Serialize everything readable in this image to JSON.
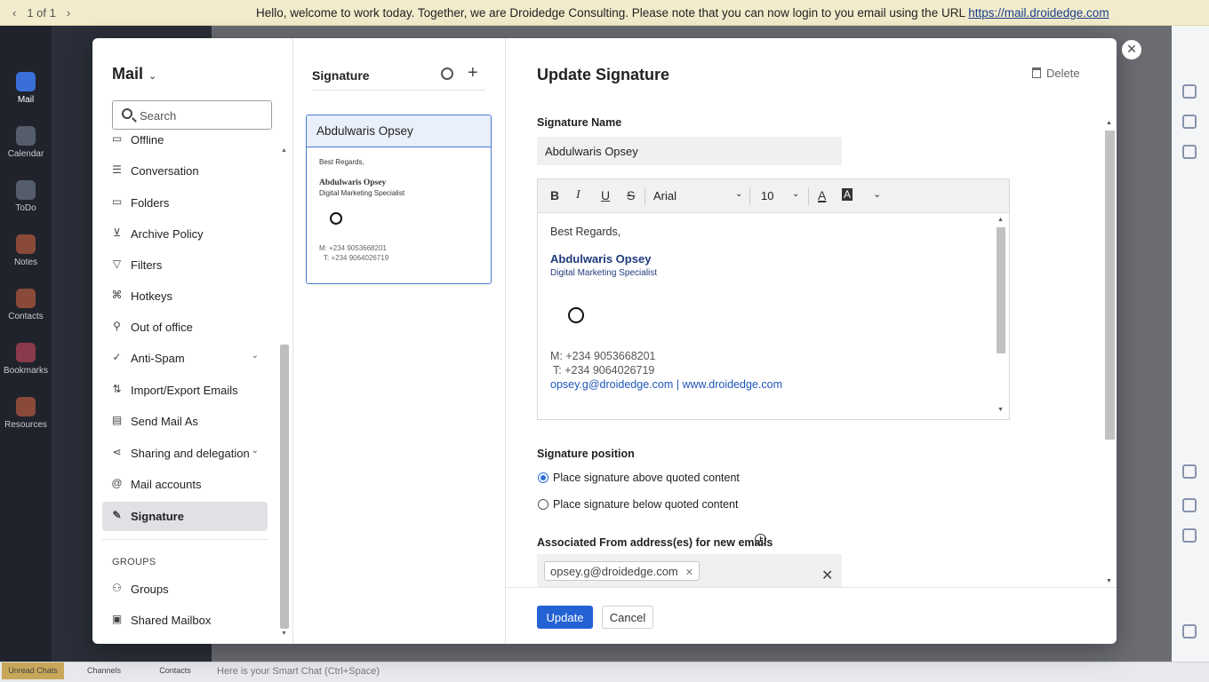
{
  "topbar": {
    "pager": "1 of 1",
    "message": "Hello, welcome to work today. Together, we are Droidedge Consulting. Please note that you can now login to you email using the URL",
    "url": "https://mail.droidedge.com"
  },
  "rail": {
    "items": [
      {
        "label": "Mail",
        "icon": "mail-icon"
      },
      {
        "label": "Calendar",
        "icon": "calendar-icon"
      },
      {
        "label": "ToDo",
        "icon": "todo-icon"
      },
      {
        "label": "Notes",
        "icon": "notes-icon"
      },
      {
        "label": "Contacts",
        "icon": "contacts-icon"
      },
      {
        "label": "Bookmarks",
        "icon": "bookmarks-icon"
      },
      {
        "label": "Resources",
        "icon": "resources-icon"
      }
    ]
  },
  "bottombar": {
    "tabs": [
      "Unread Chats",
      "Channels",
      "Contacts"
    ],
    "smart_chat": "Here is your Smart Chat (Ctrl+Space)"
  },
  "settings": {
    "title": "Mail",
    "search_placeholder": "Search",
    "nav": [
      {
        "label": "Offline",
        "icon": "offline-icon"
      },
      {
        "label": "Conversation",
        "icon": "conversation-icon"
      },
      {
        "label": "Folders",
        "icon": "folder-icon"
      },
      {
        "label": "Archive Policy",
        "icon": "archive-icon"
      },
      {
        "label": "Filters",
        "icon": "filter-icon"
      },
      {
        "label": "Hotkeys",
        "icon": "command-icon"
      },
      {
        "label": "Out of office",
        "icon": "out-of-office-icon"
      },
      {
        "label": "Anti-Spam",
        "icon": "shield-check-icon"
      },
      {
        "label": "Import/Export Emails",
        "icon": "import-export-icon"
      },
      {
        "label": "Send Mail As",
        "icon": "send-as-icon"
      },
      {
        "label": "Sharing and delegation",
        "icon": "share-icon"
      },
      {
        "label": "Mail accounts",
        "icon": "at-icon"
      },
      {
        "label": "Signature",
        "icon": "signature-icon"
      }
    ],
    "groups_heading": "GROUPS",
    "groups": [
      {
        "label": "Groups",
        "icon": "groups-icon"
      },
      {
        "label": "Shared Mailbox",
        "icon": "shared-mailbox-icon"
      }
    ]
  },
  "signature_list": {
    "heading": "Signature",
    "card": {
      "name": "Abdulwaris Opsey",
      "greeting": "Best Regards,",
      "person": "Abdulwaris Opsey",
      "role": "Digital Marketing Specialist",
      "mobile": "M: +234 9053668201",
      "tel": "T: +234 9064026719"
    }
  },
  "editor": {
    "title": "Update Signature",
    "delete_label": "Delete",
    "name_label": "Signature Name",
    "name_value": "Abdulwaris Opsey",
    "toolbar": {
      "bold": "B",
      "italic": "I",
      "underline": "U",
      "strike": "S",
      "font": "Arial",
      "size": "10",
      "font_color": "A",
      "highlight": "A"
    },
    "body": {
      "greeting": "Best Regards,",
      "name": "Abdulwaris Opsey",
      "role": "Digital Marketing Specialist",
      "mobile": "M: +234 9053668201",
      "tel": "T: +234 9064026719",
      "email": "opsey.g@droidedge.com",
      "sep": " | ",
      "web": "www.droidedge.com"
    },
    "position_label": "Signature position",
    "position_above": "Place signature above quoted content",
    "position_below": "Place signature below quoted content",
    "position_selected": "above",
    "assoc_label": "Associated From address(es) for new emails",
    "assoc_chip": "opsey.g@droidedge.com",
    "update_label": "Update",
    "cancel_label": "Cancel"
  },
  "colors": {
    "accent": "#2462d4",
    "selected_card": "#e9f0fb",
    "active_nav": "#dfe1e5"
  }
}
